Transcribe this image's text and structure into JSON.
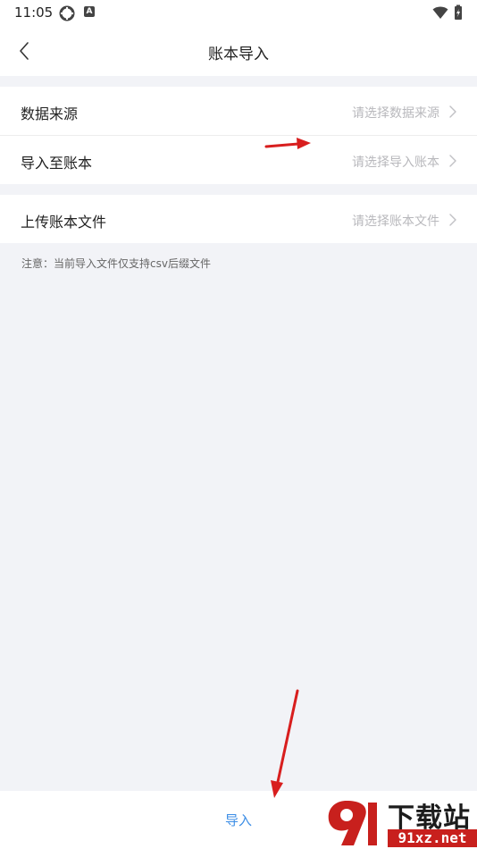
{
  "status_bar": {
    "time": "11:05",
    "badge_letter": "A",
    "icons": [
      "notification-dot-icon",
      "keyboard-a-icon",
      "wifi-icon",
      "battery-icon"
    ]
  },
  "header": {
    "title": "账本导入",
    "back_icon": "chevron-left-icon"
  },
  "form": {
    "rows": [
      {
        "label": "数据来源",
        "placeholder": "请选择数据来源"
      },
      {
        "label": "导入至账本",
        "placeholder": "请选择导入账本"
      },
      {
        "label": "上传账本文件",
        "placeholder": "请选择账本文件"
      }
    ],
    "note": "注意：当前导入文件仅支持csv后缀文件"
  },
  "footer": {
    "import_label": "导入"
  },
  "watermark": {
    "chinese": "下载站",
    "url": "91xz.net"
  },
  "colors": {
    "background": "#f2f3f7",
    "accent": "#3d8ee6",
    "placeholder": "#b8b8bc",
    "annotation_arrow": "#d81e1e",
    "watermark_red": "#c8201d"
  }
}
